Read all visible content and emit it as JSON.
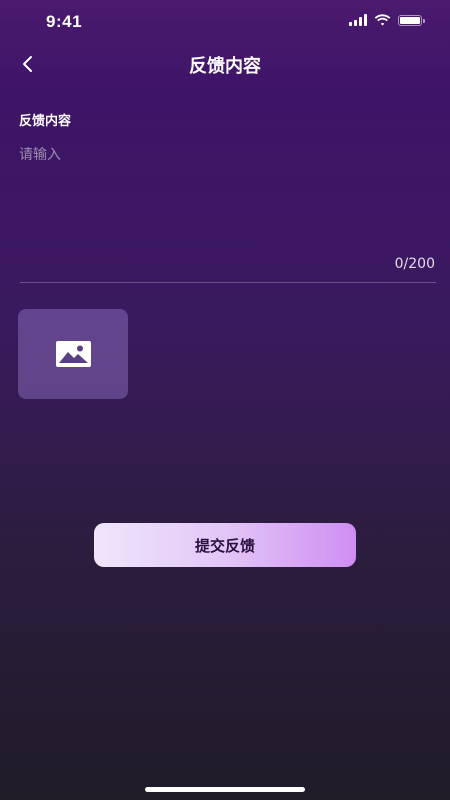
{
  "status_bar": {
    "time": "9:41"
  },
  "nav": {
    "title": "反馈内容"
  },
  "form": {
    "label": "反馈内容",
    "placeholder": "请输入",
    "value": "",
    "char_count": "0/200"
  },
  "upload": {
    "icon": "image-icon"
  },
  "submit": {
    "label": "提交反馈"
  },
  "colors": {
    "background_top": "#4a1a6e",
    "background_bottom": "#1f1c28",
    "button_gradient_start": "#efe6fb",
    "button_gradient_end": "#cf8ef2",
    "upload_box": "#6b4e95"
  }
}
